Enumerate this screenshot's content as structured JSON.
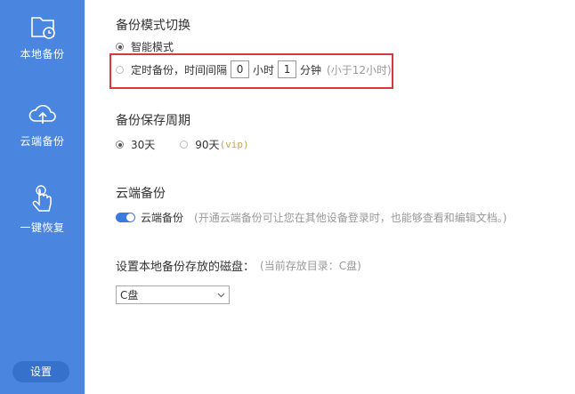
{
  "sidebar": {
    "items": [
      {
        "label": "本地备份",
        "icon": "folder-clock-icon"
      },
      {
        "label": "云端备份",
        "icon": "cloud-upload-icon"
      },
      {
        "label": "一键恢复",
        "icon": "hand-tap-icon"
      }
    ],
    "settings_label": "设置",
    "background": "#4a86e0"
  },
  "backup_mode": {
    "title": "备份模式切换",
    "smart_label": "智能模式",
    "scheduled_label": "定时备份，时间间隔",
    "hours_value": "0",
    "hours_unit": "小时",
    "minutes_value": "1",
    "minutes_unit": "分钟",
    "hint": "(小于12小时)"
  },
  "retention": {
    "title": "备份保存周期",
    "option_30": "30天",
    "option_90": "90天",
    "vip_tag": "(vip)"
  },
  "cloud": {
    "title": "云端备份",
    "toggle_label": "云端备份",
    "hint": "(开通云端备份可让您在其他设备登录时，也能够查看和编辑文档。)"
  },
  "disk": {
    "label": "设置本地备份存放的磁盘：",
    "current": "(当前存放目录：C盘)",
    "selected": "C盘"
  },
  "accent": "#d9363e"
}
